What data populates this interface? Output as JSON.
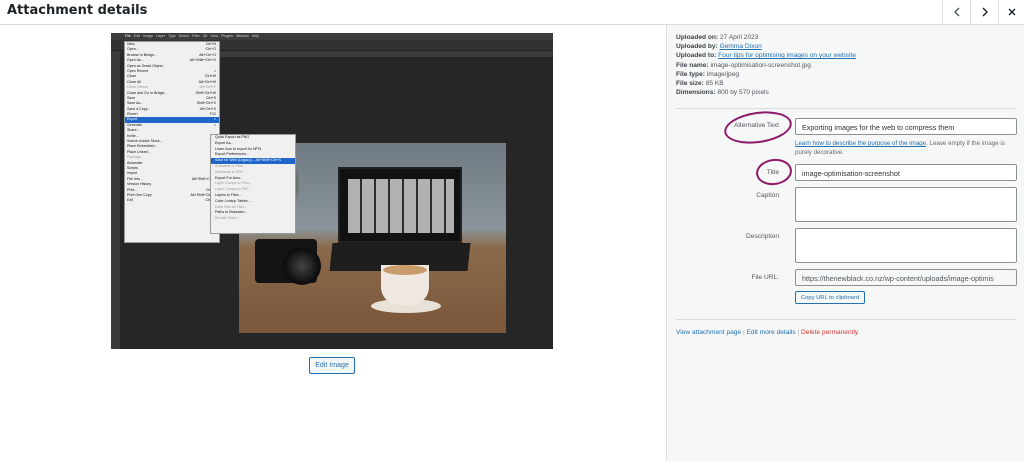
{
  "header": {
    "title": "Attachment details"
  },
  "photoshop": {
    "menubar": [
      "File",
      "Edit",
      "Image",
      "Layer",
      "Type",
      "Select",
      "Filter",
      "3D",
      "View",
      "Plugins",
      "Window",
      "Help"
    ],
    "file_menu": [
      {
        "label": "New...",
        "shortcut": "Ctrl+N"
      },
      {
        "label": "Open...",
        "shortcut": "Ctrl+O"
      },
      {
        "label": "Browse in Bridge...",
        "shortcut": "Alt+Ctrl+O"
      },
      {
        "label": "Open As...",
        "shortcut": "Alt+Shift+Ctrl+O"
      },
      {
        "label": "Open as Smart Object...",
        "shortcut": ""
      },
      {
        "label": "Open Recent",
        "shortcut": ">"
      },
      {
        "label": "Close",
        "shortcut": "Ctrl+W"
      },
      {
        "label": "Close All",
        "shortcut": "Alt+Ctrl+W"
      },
      {
        "label": "Close Others",
        "shortcut": "Alt+Ctrl+P"
      },
      {
        "label": "Close and Go to Bridge...",
        "shortcut": "Shift+Ctrl+W"
      },
      {
        "label": "Save",
        "shortcut": "Ctrl+S"
      },
      {
        "label": "Save As...",
        "shortcut": "Shift+Ctrl+S"
      },
      {
        "label": "Save a Copy...",
        "shortcut": "Alt+Ctrl+S"
      },
      {
        "label": "Revert",
        "shortcut": "F12"
      },
      {
        "label": "Export",
        "shortcut": ">"
      },
      {
        "label": "Generate",
        "shortcut": ">"
      },
      {
        "label": "Share...",
        "shortcut": ""
      },
      {
        "label": "Invite...",
        "shortcut": ""
      },
      {
        "label": "Search Adobe Stock...",
        "shortcut": ""
      },
      {
        "label": "Place Embedded...",
        "shortcut": ""
      },
      {
        "label": "Place Linked...",
        "shortcut": ""
      },
      {
        "label": "Package...",
        "shortcut": ""
      },
      {
        "label": "Automate",
        "shortcut": ">"
      },
      {
        "label": "Scripts",
        "shortcut": ">"
      },
      {
        "label": "Import",
        "shortcut": ">"
      },
      {
        "label": "File Info...",
        "shortcut": "Alt+Shift+Ctrl+I"
      },
      {
        "label": "Version History",
        "shortcut": ""
      },
      {
        "label": "Print...",
        "shortcut": "Ctrl+P"
      },
      {
        "label": "Print One Copy",
        "shortcut": "Alt+Shift+Ctrl+P"
      },
      {
        "label": "Exit",
        "shortcut": "Ctrl+Q"
      }
    ],
    "export_menu": [
      "Quick Export as PNG",
      "Export As...",
      "Learn how to export for NFTs",
      "Export Preferences...",
      "Save for Web (Legacy)...",
      "Artboards to Files...",
      "Artboards to PDF...",
      "Export For Aero...",
      "Layer Comps to Files...",
      "Layer Comps to PDF...",
      "Layers to Files...",
      "Color Lookup Tables...",
      "Data Sets as Files...",
      "Paths to Illustrator...",
      "Render Video..."
    ],
    "export_selected_shortcut": "Alt+Shift+Ctrl+S"
  },
  "left": {
    "edit_image_label": "Edit Image"
  },
  "meta": {
    "uploaded_on_label": "Uploaded on:",
    "uploaded_on": "27 April 2023",
    "uploaded_by_label": "Uploaded by:",
    "uploaded_by": "Gemma Dixon",
    "uploaded_to_label": "Uploaded to:",
    "uploaded_to": "Four tips for optimising images on your website",
    "file_name_label": "File name:",
    "file_name": "image-optimisation-screenshot.jpg",
    "file_type_label": "File type:",
    "file_type": "image/jpeg",
    "file_size_label": "File size:",
    "file_size": "85 KB",
    "dimensions_label": "Dimensions:",
    "dimensions": "800 by 570 pixels"
  },
  "form": {
    "alt_label": "Alternative Text",
    "alt_value": "Exporting images for the web to compress them",
    "help_link": "Learn how to describe the purpose of the image",
    "help_text": ". Leave empty if the image is purely decorative.",
    "title_label": "Title",
    "title_value": "image-optimisation-screenshot",
    "caption_label": "Caption",
    "caption_value": "",
    "description_label": "Description",
    "description_value": "",
    "file_url_label": "File URL:",
    "file_url_value": "https://thenewblack.co.nz/wp-content/uploads/image-optimis",
    "copy_url_label": "Copy URL to clipboard"
  },
  "actions": {
    "view": "View attachment page",
    "sep1": " | ",
    "edit": "Edit more details",
    "sep2": " | ",
    "delete": "Delete permanently"
  },
  "colors": {
    "link": "#2271b1",
    "delete": "#d63638",
    "annotation": "#8e1a6b",
    "ps_highlight": "#1e66c8"
  }
}
